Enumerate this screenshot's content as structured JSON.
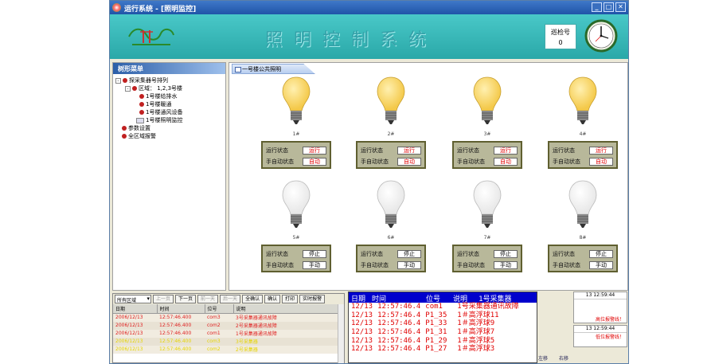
{
  "window": {
    "title": "运行系统 - [照明监控]",
    "controls": [
      "_",
      "□",
      "✕"
    ]
  },
  "header": {
    "system_title": "照明控制系统",
    "info_label": "巡检号",
    "info_value": "0"
  },
  "nav_panel": {
    "header": "树形菜单",
    "tree": [
      {
        "label": "探采集器号排列",
        "level": 0
      },
      {
        "label": "区域：   1,2,3号楼",
        "level": 1
      },
      {
        "label": "1号楼给排水",
        "level": 2
      },
      {
        "label": "1号楼暖通",
        "level": 2
      },
      {
        "label": "1号楼通风设备",
        "level": 2
      },
      {
        "label": "1号楼照明监控",
        "level": 2
      },
      {
        "label": "参数设置",
        "level": 0
      },
      {
        "label": "全区域报警",
        "level": 0
      }
    ]
  },
  "main": {
    "tab_label": "一号楼公共照明",
    "status_label": "运行状态",
    "mode_label": "手自动状态",
    "lamps": [
      {
        "number": "1#",
        "run": "运行",
        "mode": "自动",
        "on": true
      },
      {
        "number": "2#",
        "run": "运行",
        "mode": "自动",
        "on": true
      },
      {
        "number": "3#",
        "run": "运行",
        "mode": "自动",
        "on": true
      },
      {
        "number": "4#",
        "run": "运行",
        "mode": "自动",
        "on": true
      },
      {
        "number": "5#",
        "run": "停止",
        "mode": "手动",
        "on": false
      },
      {
        "number": "6#",
        "run": "停止",
        "mode": "手动",
        "on": false
      },
      {
        "number": "7#",
        "run": "停止",
        "mode": "手动",
        "on": false
      },
      {
        "number": "8#",
        "run": "停止",
        "mode": "手动",
        "on": false
      }
    ]
  },
  "alarm_log": {
    "area_select": "所有区域",
    "buttons": [
      {
        "label": "上一页",
        "enabled": false
      },
      {
        "label": "下一页",
        "enabled": true
      },
      {
        "label": "前一天",
        "enabled": false
      },
      {
        "label": "后一天",
        "enabled": false
      },
      {
        "label": "全确认",
        "enabled": true
      },
      {
        "label": "确认",
        "enabled": true
      },
      {
        "label": "打印",
        "enabled": true
      },
      {
        "label": "实时报警",
        "enabled": true
      }
    ],
    "columns": [
      "日期",
      "时间",
      "位号",
      "说明"
    ],
    "rows": [
      [
        "2006/12/13",
        "12:57:46.400",
        "com3",
        "3号采集器通讯故障"
      ],
      [
        "2006/12/13",
        "12:57:46.400",
        "com2",
        "2号采集器通讯故障"
      ],
      [
        "2006/12/13",
        "12:57:46.400",
        "com1",
        "1号采集器通讯故障"
      ],
      [
        "2006/12/13",
        "12:57:46.400",
        "com3",
        "3号采集器"
      ],
      [
        "2006/12/13",
        "12:57:46.400",
        "com2",
        "2号采集器"
      ]
    ]
  },
  "realtime": {
    "columns": [
      "日期",
      "时间",
      "位号",
      "说明",
      "1号采集器"
    ],
    "rows": [
      [
        "12/13",
        "12:57:46.4",
        "com1",
        "1号采集器通讯故障"
      ],
      [
        "12/13",
        "12:57:46.4",
        "P1_35",
        "1＃高浮球11"
      ],
      [
        "12/13",
        "12:57:46.4",
        "P1_33",
        "1＃高浮球9"
      ],
      [
        "12/13",
        "12:57:46.4",
        "P1_31",
        "1＃高浮球7"
      ],
      [
        "12/13",
        "12:57:46.4",
        "P1_29",
        "1＃高浮球5"
      ],
      [
        "12/13",
        "12:57:46.4",
        "P1_27",
        "1＃高浮球3"
      ]
    ]
  },
  "side_alarm": {
    "time1": "13 12:59:44",
    "text1": "高位报警线！",
    "time2": "13 12:59:44",
    "text2": "低位报警线！",
    "left_label": "左移",
    "right_label": "右移"
  },
  "colors": {
    "banner": "#2aa8a8",
    "alarm_red": "#e00000",
    "alarm_yellow": "#e6d400",
    "panel_olive": "#b8b89a",
    "msg_head": "#0000cc"
  }
}
